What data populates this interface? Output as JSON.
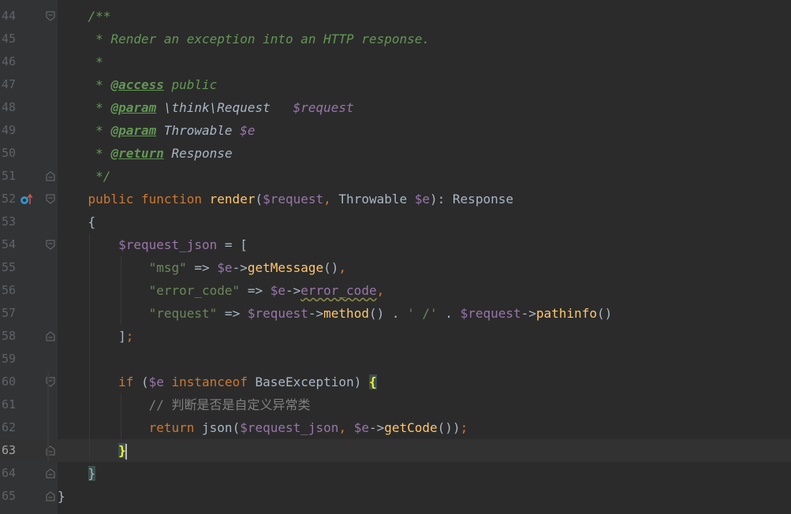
{
  "editor": {
    "lines": [
      {
        "n": "44",
        "tokens": [
          {
            "t": "    "
          },
          {
            "t": "/**",
            "c": "c-doc"
          }
        ]
      },
      {
        "n": "45",
        "tokens": [
          {
            "t": "     "
          },
          {
            "t": "* Render an exception into an HTTP response.",
            "c": "c-doc"
          }
        ]
      },
      {
        "n": "46",
        "tokens": [
          {
            "t": "     "
          },
          {
            "t": "*",
            "c": "c-doc"
          }
        ]
      },
      {
        "n": "47",
        "tokens": [
          {
            "t": "     "
          },
          {
            "t": "* ",
            "c": "c-doc"
          },
          {
            "t": "@access",
            "c": "c-tag"
          },
          {
            "t": " public",
            "c": "c-doc"
          }
        ]
      },
      {
        "n": "48",
        "tokens": [
          {
            "t": "     "
          },
          {
            "t": "* ",
            "c": "c-doc"
          },
          {
            "t": "@param",
            "c": "c-tag"
          },
          {
            "t": " \\think\\Request   ",
            "c": "c-dtype"
          },
          {
            "t": "$request",
            "c": "c-dvar"
          }
        ]
      },
      {
        "n": "49",
        "tokens": [
          {
            "t": "     "
          },
          {
            "t": "* ",
            "c": "c-doc"
          },
          {
            "t": "@param",
            "c": "c-tag"
          },
          {
            "t": " Throwable ",
            "c": "c-dtype"
          },
          {
            "t": "$e",
            "c": "c-dvar"
          }
        ]
      },
      {
        "n": "50",
        "tokens": [
          {
            "t": "     "
          },
          {
            "t": "* ",
            "c": "c-doc"
          },
          {
            "t": "@return",
            "c": "c-tag"
          },
          {
            "t": " Response",
            "c": "c-dtype"
          }
        ]
      },
      {
        "n": "51",
        "tokens": [
          {
            "t": "     "
          },
          {
            "t": "*/",
            "c": "c-doc"
          }
        ]
      },
      {
        "n": "52",
        "tokens": [
          {
            "t": "    "
          },
          {
            "t": "public function ",
            "c": "kw"
          },
          {
            "t": "render",
            "c": "fn"
          },
          {
            "t": "(",
            "c": "txt"
          },
          {
            "t": "$request",
            "c": "var"
          },
          {
            "t": ", ",
            "c": "kw"
          },
          {
            "t": "Throwable ",
            "c": "txt"
          },
          {
            "t": "$e",
            "c": "var"
          },
          {
            "t": "): Response",
            "c": "txt"
          }
        ]
      },
      {
        "n": "53",
        "tokens": [
          {
            "t": "    "
          },
          {
            "t": "{",
            "c": "txt"
          }
        ]
      },
      {
        "n": "54",
        "tokens": [
          {
            "t": "        "
          },
          {
            "t": "$request_json",
            "c": "var"
          },
          {
            "t": " = [",
            "c": "txt"
          }
        ]
      },
      {
        "n": "55",
        "tokens": [
          {
            "t": "            "
          },
          {
            "t": "\"msg\"",
            "c": "str"
          },
          {
            "t": " => ",
            "c": "txt"
          },
          {
            "t": "$e",
            "c": "var"
          },
          {
            "t": "->",
            "c": "txt"
          },
          {
            "t": "getMessage",
            "c": "mcall"
          },
          {
            "t": "()",
            "c": "txt"
          },
          {
            "t": ",",
            "c": "kw"
          }
        ]
      },
      {
        "n": "56",
        "tokens": [
          {
            "t": "            "
          },
          {
            "t": "\"error_code\"",
            "c": "str"
          },
          {
            "t": " => ",
            "c": "txt"
          },
          {
            "t": "$e",
            "c": "var"
          },
          {
            "t": "->",
            "c": "txt"
          },
          {
            "t": "error_code",
            "c": "var warn"
          },
          {
            "t": ",",
            "c": "kw"
          }
        ]
      },
      {
        "n": "57",
        "tokens": [
          {
            "t": "            "
          },
          {
            "t": "\"request\"",
            "c": "str"
          },
          {
            "t": " => ",
            "c": "txt"
          },
          {
            "t": "$request",
            "c": "var"
          },
          {
            "t": "->",
            "c": "txt"
          },
          {
            "t": "method",
            "c": "mcall"
          },
          {
            "t": "() . ",
            "c": "txt"
          },
          {
            "t": "' /'",
            "c": "str"
          },
          {
            "t": " . ",
            "c": "txt"
          },
          {
            "t": "$request",
            "c": "var"
          },
          {
            "t": "->",
            "c": "txt"
          },
          {
            "t": "pathinfo",
            "c": "mcall"
          },
          {
            "t": "()",
            "c": "txt"
          }
        ]
      },
      {
        "n": "58",
        "tokens": [
          {
            "t": "        "
          },
          {
            "t": "]",
            "c": "txt"
          },
          {
            "t": ";",
            "c": "kw"
          }
        ]
      },
      {
        "n": "59",
        "tokens": []
      },
      {
        "n": "60",
        "tokens": [
          {
            "t": "        "
          },
          {
            "t": "if ",
            "c": "kw"
          },
          {
            "t": "(",
            "c": "txt"
          },
          {
            "t": "$e",
            "c": "var"
          },
          {
            "t": " instanceof ",
            "c": "kw"
          },
          {
            "t": "BaseException) ",
            "c": "txt"
          },
          {
            "t": "{",
            "c": "brace-hl"
          }
        ]
      },
      {
        "n": "61",
        "tokens": [
          {
            "t": "            "
          },
          {
            "t": "// 判断是否是自定义异常类",
            "c": "cmt"
          }
        ]
      },
      {
        "n": "62",
        "tokens": [
          {
            "t": "            "
          },
          {
            "t": "return ",
            "c": "kw"
          },
          {
            "t": "json(",
            "c": "txt"
          },
          {
            "t": "$request_json",
            "c": "var"
          },
          {
            "t": ", ",
            "c": "kw"
          },
          {
            "t": "$e",
            "c": "var"
          },
          {
            "t": "->",
            "c": "txt"
          },
          {
            "t": "getCode",
            "c": "mcall"
          },
          {
            "t": "())",
            "c": "txt"
          },
          {
            "t": ";",
            "c": "kw"
          }
        ]
      },
      {
        "n": "63",
        "tokens": [
          {
            "t": "        "
          },
          {
            "t": "}",
            "c": "brace-hl"
          },
          {
            "t": "",
            "c": "caret"
          }
        ]
      },
      {
        "n": "64",
        "tokens": [
          {
            "t": "    "
          },
          {
            "t": "}",
            "c": "brace-soft txt"
          }
        ]
      },
      {
        "n": "65",
        "tokens": [
          {
            "t": "}",
            "c": "txt"
          }
        ]
      }
    ],
    "current_line": "63"
  }
}
